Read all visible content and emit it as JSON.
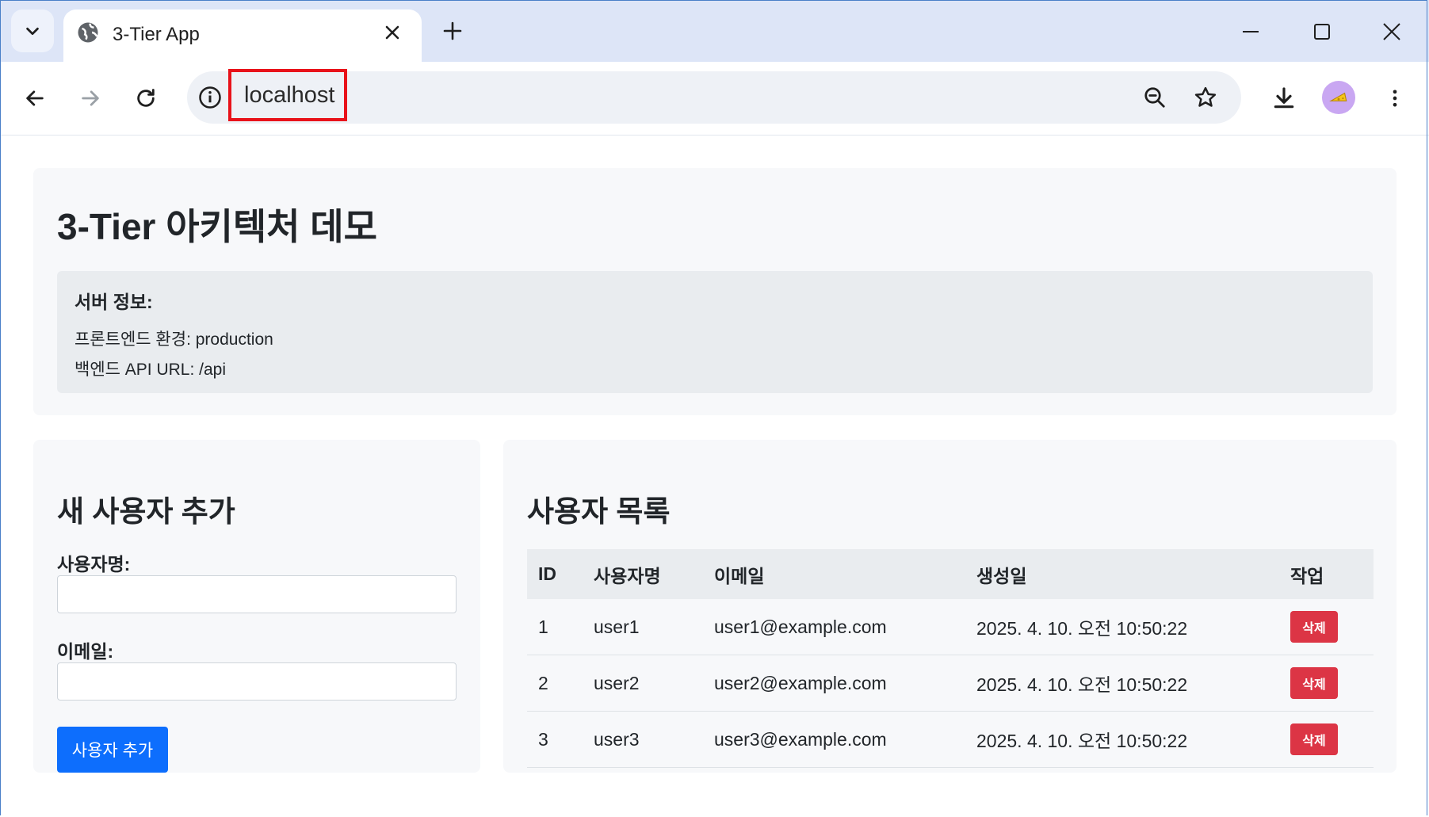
{
  "browser": {
    "tab_title": "3-Tier App",
    "url": "localhost",
    "colors": {
      "tabstrip": "#dde5f7",
      "highlight": "#e8121a"
    }
  },
  "page": {
    "title": "3-Tier 아키텍처 데모",
    "server_info": {
      "heading": "서버 정보:",
      "frontend_env": "프론트엔드 환경: production",
      "backend_url": "백엔드 API URL: /api"
    },
    "form": {
      "title": "새 사용자 추가",
      "username_label": "사용자명:",
      "username_value": "",
      "email_label": "이메일:",
      "email_value": "",
      "submit_label": "사용자 추가"
    },
    "list": {
      "title": "사용자 목록",
      "headers": [
        "ID",
        "사용자명",
        "이메일",
        "생성일",
        "작업"
      ],
      "rows": [
        {
          "id": "1",
          "username": "user1",
          "email": "user1@example.com",
          "created": "2025. 4. 10. 오전 10:50:22",
          "action": "삭제"
        },
        {
          "id": "2",
          "username": "user2",
          "email": "user2@example.com",
          "created": "2025. 4. 10. 오전 10:50:22",
          "action": "삭제"
        },
        {
          "id": "3",
          "username": "user3",
          "email": "user3@example.com",
          "created": "2025. 4. 10. 오전 10:50:22",
          "action": "삭제"
        }
      ]
    },
    "colors": {
      "primary": "#0d6efd",
      "danger": "#dc3545"
    }
  }
}
